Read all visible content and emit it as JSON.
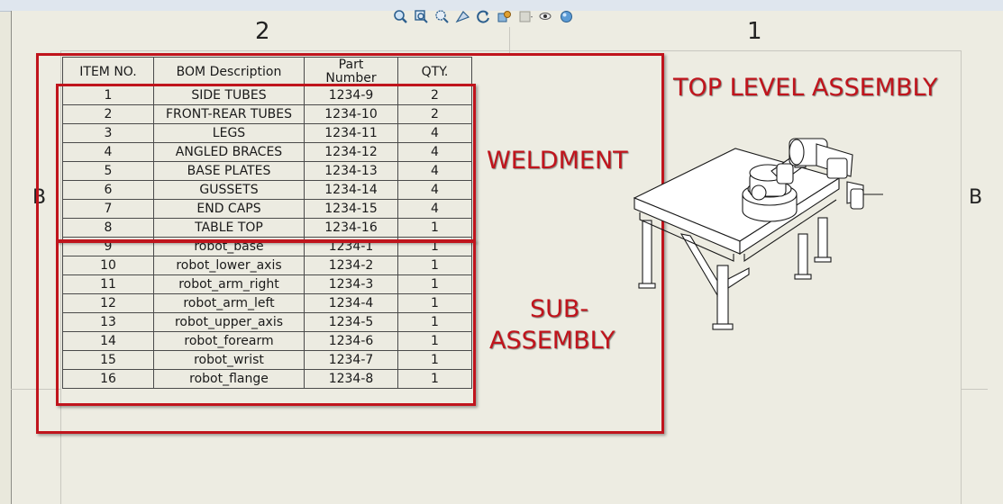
{
  "zones": {
    "top_left": "2",
    "top_right": "1",
    "side_left": "B",
    "side_right": "B"
  },
  "toolbar_icons": [
    "zoom-to-fit-icon",
    "zoom-area-icon",
    "previous-view-icon",
    "section-view-icon",
    "rotate-icon",
    "display-style-icon",
    "hide-show-icon",
    "view-setting-icon",
    "appearance-icon"
  ],
  "bom": {
    "headers": {
      "item": "ITEM NO.",
      "description": "BOM Description",
      "part_line1": "Part",
      "part_line2": "Number",
      "qty": "QTY."
    },
    "rows": [
      {
        "item": "1",
        "description": "SIDE TUBES",
        "part": "1234-9",
        "qty": "2"
      },
      {
        "item": "2",
        "description": "FRONT-REAR TUBES",
        "part": "1234-10",
        "qty": "2"
      },
      {
        "item": "3",
        "description": "LEGS",
        "part": "1234-11",
        "qty": "4"
      },
      {
        "item": "4",
        "description": "ANGLED BRACES",
        "part": "1234-12",
        "qty": "4"
      },
      {
        "item": "5",
        "description": "BASE PLATES",
        "part": "1234-13",
        "qty": "4"
      },
      {
        "item": "6",
        "description": "GUSSETS",
        "part": "1234-14",
        "qty": "4"
      },
      {
        "item": "7",
        "description": "END CAPS",
        "part": "1234-15",
        "qty": "4"
      },
      {
        "item": "8",
        "description": "TABLE TOP",
        "part": "1234-16",
        "qty": "1"
      },
      {
        "item": "9",
        "description": "robot_base",
        "part": "1234-1",
        "qty": "1"
      },
      {
        "item": "10",
        "description": "robot_lower_axis",
        "part": "1234-2",
        "qty": "1"
      },
      {
        "item": "11",
        "description": "robot_arm_right",
        "part": "1234-3",
        "qty": "1"
      },
      {
        "item": "12",
        "description": "robot_arm_left",
        "part": "1234-4",
        "qty": "1"
      },
      {
        "item": "13",
        "description": "robot_upper_axis",
        "part": "1234-5",
        "qty": "1"
      },
      {
        "item": "14",
        "description": "robot_forearm",
        "part": "1234-6",
        "qty": "1"
      },
      {
        "item": "15",
        "description": "robot_wrist",
        "part": "1234-7",
        "qty": "1"
      },
      {
        "item": "16",
        "description": "robot_flange",
        "part": "1234-8",
        "qty": "1"
      }
    ]
  },
  "annotations": {
    "top_level": "TOP LEVEL ASSEMBLY",
    "weldment": "WELDMENT",
    "sub_line1": "SUB-",
    "sub_line2": "ASSEMBLY",
    "color": "#c0141c"
  }
}
